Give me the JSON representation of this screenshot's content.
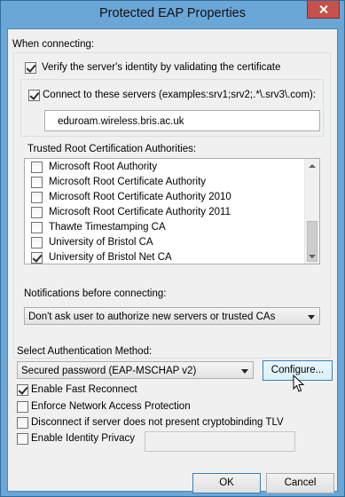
{
  "window": {
    "title": "Protected EAP Properties"
  },
  "when_connecting_label": "When connecting:",
  "verify_identity": {
    "label": "Verify the server's identity by validating the certificate",
    "checked": true
  },
  "connect_to_servers": {
    "label": "Connect to these servers (examples:srv1;srv2;.*\\.srv3\\.com):",
    "checked": true
  },
  "servers_field": {
    "value": "eduroam.wireless.bris.ac.uk"
  },
  "trusted_roots_label": "Trusted Root Certification Authorities:",
  "trusted_roots": [
    {
      "label": "Microsoft Root Authority",
      "checked": false
    },
    {
      "label": "Microsoft Root Certificate Authority",
      "checked": false
    },
    {
      "label": "Microsoft Root Certificate Authority 2010",
      "checked": false
    },
    {
      "label": "Microsoft Root Certificate Authority 2011",
      "checked": false
    },
    {
      "label": "Thawte Timestamping CA",
      "checked": false
    },
    {
      "label": "University of Bristol CA",
      "checked": false
    },
    {
      "label": "University of Bristol Net CA",
      "checked": true
    }
  ],
  "notifications_label": "Notifications before connecting:",
  "notifications_select": {
    "value": "Don't ask user to authorize new servers or trusted CAs"
  },
  "auth_method_label": "Select Authentication Method:",
  "auth_method_select": {
    "value": "Secured password (EAP-MSCHAP v2)"
  },
  "configure_button": "Configure...",
  "options": {
    "fast_reconnect": {
      "label": "Enable Fast Reconnect",
      "checked": true
    },
    "nap": {
      "label": "Enforce Network Access Protection",
      "checked": false
    },
    "cryptobinding": {
      "label": "Disconnect if server does not present cryptobinding TLV",
      "checked": false
    },
    "identity_privacy": {
      "label": "Enable Identity Privacy",
      "checked": false
    }
  },
  "identity_privacy_field": {
    "value": ""
  },
  "ok_button": "OK",
  "cancel_button": "Cancel",
  "colors": {
    "title_bar": "#6aa6d6",
    "close": "#c7504a",
    "client": "#f0f0f0"
  }
}
